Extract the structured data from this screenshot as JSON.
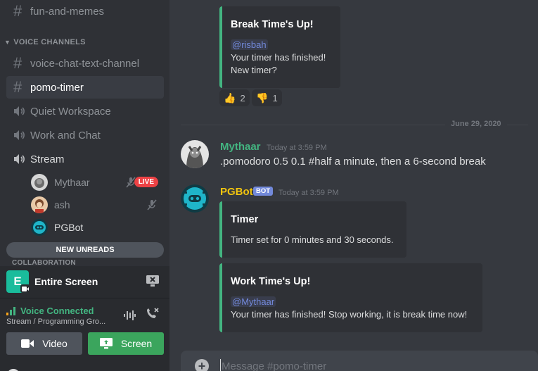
{
  "sidebar": {
    "top_channel": "fun-and-memes",
    "voice_category": "VOICE CHANNELS",
    "text_channels": [
      "voice-chat-text-channel",
      "pomo-timer"
    ],
    "voice_channels": [
      "Quiet Workspace",
      "Work and Chat",
      "Stream"
    ],
    "stream_users": [
      {
        "name": "Mythaar",
        "badge": "LIVE"
      },
      {
        "name": "ash"
      },
      {
        "name": "PGBot"
      }
    ],
    "new_unreads": "NEW UNREADS",
    "collab_category": "COLLABORATION"
  },
  "share": {
    "app_letter": "E",
    "title": "Entire Screen"
  },
  "voice": {
    "status": "Voice Connected",
    "channel": "Stream / Programming Gro...",
    "video_label": "Video",
    "screen_label": "Screen"
  },
  "messages": {
    "break_embed": {
      "title": "Break Time's Up!",
      "mention": "@risbah",
      "line1": "Your timer has finished!",
      "line2": "New timer?"
    },
    "reactions": [
      {
        "emoji": "👍",
        "count": "2"
      },
      {
        "emoji": "👎",
        "count": "1"
      }
    ],
    "divider_date": "June 29, 2020",
    "mythaar": {
      "author": "Mythaar",
      "timestamp": "Today at 3:59 PM",
      "text": ".pomodoro 0.5 0.1 #half a minute, then a 6-second break"
    },
    "pgbot": {
      "author": "PGBot",
      "badge": "BOT",
      "timestamp": "Today at 3:59 PM"
    },
    "timer_embed": {
      "title": "Timer",
      "text": "Timer set for 0 minutes and 30 seconds."
    },
    "work_embed": {
      "title": "Work Time's Up!",
      "mention": "@Mythaar",
      "text": "Your timer has finished! Stop working, it is break time now!"
    }
  },
  "composer": {
    "placeholder": "Message #pomo-timer"
  },
  "colors": {
    "accent_green": "#43b581",
    "mythaar_color": "#43b581",
    "pgbot_color": "#f1c40f",
    "live_red": "#ed4245",
    "blurple": "#7289da"
  }
}
